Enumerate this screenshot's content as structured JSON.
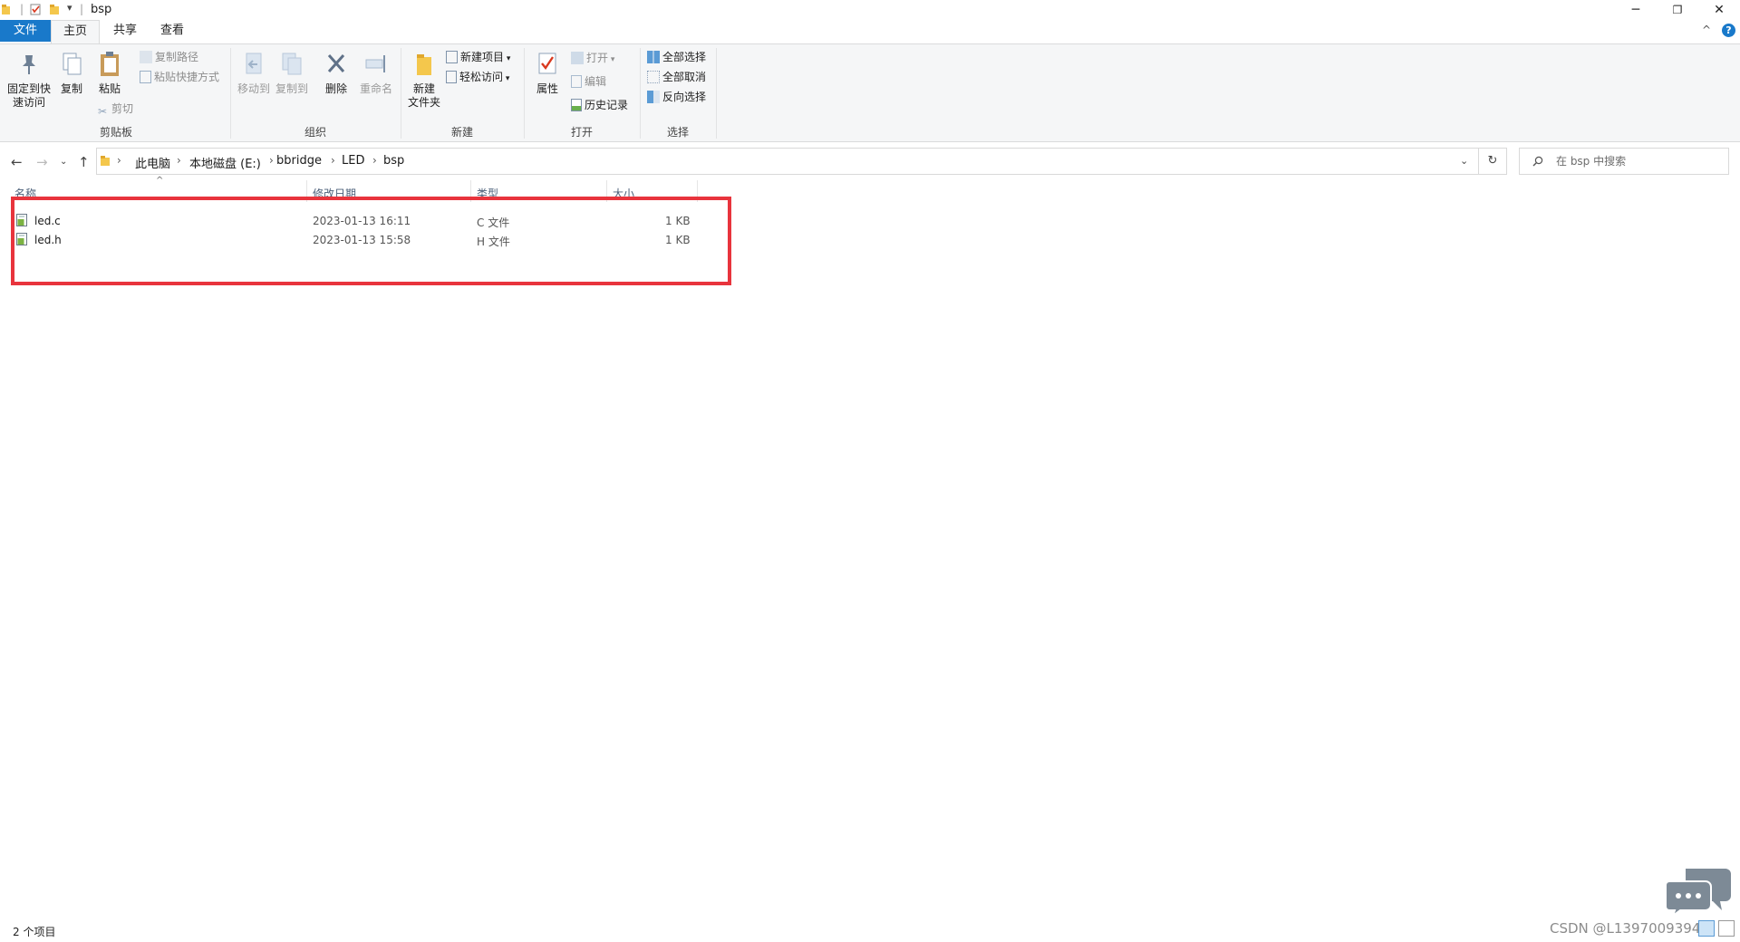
{
  "window": {
    "title": "bsp",
    "minimize_glyph": "─",
    "restore_glyph": "❐",
    "close_glyph": "✕"
  },
  "ribbon_tabs": [
    "文件",
    "主页",
    "共享",
    "查看"
  ],
  "ribbon": {
    "clipboard": {
      "label": "剪贴板",
      "pin": "固定到快\n速访问",
      "copy": "复制",
      "paste": "粘贴",
      "copy_path": "复制路径",
      "paste_shortcut": "粘贴快捷方式",
      "cut": "剪切"
    },
    "organize": {
      "label": "组织",
      "move_to": "移动到",
      "copy_to": "复制到",
      "delete": "删除",
      "rename": "重命名"
    },
    "new": {
      "label": "新建",
      "new_folder": "新建\n文件夹",
      "new_item": "新建项目",
      "easy_access": "轻松访问"
    },
    "open": {
      "label": "打开",
      "properties": "属性",
      "open": "打开",
      "edit": "编辑",
      "history": "历史记录"
    },
    "select": {
      "label": "选择",
      "select_all": "全部选择",
      "select_none": "全部取消",
      "invert": "反向选择"
    }
  },
  "breadcrumb": [
    "此电脑",
    "本地磁盘 (E:)",
    "bbridge",
    "LED",
    "bsp"
  ],
  "search": {
    "placeholder": "在 bsp 中搜索"
  },
  "columns": {
    "name": "名称",
    "date": "修改日期",
    "type": "类型",
    "size": "大小"
  },
  "files": [
    {
      "name": "led.c",
      "date": "2023-01-13 16:11",
      "type": "C 文件",
      "size": "1 KB"
    },
    {
      "name": "led.h",
      "date": "2023-01-13 15:58",
      "type": "H 文件",
      "size": "1 KB"
    }
  ],
  "status": {
    "item_count": "2 个项目"
  },
  "watermark": "CSDN @L13970093940",
  "colors": {
    "accent": "#1979ca",
    "highlight_box": "#e8343d"
  }
}
